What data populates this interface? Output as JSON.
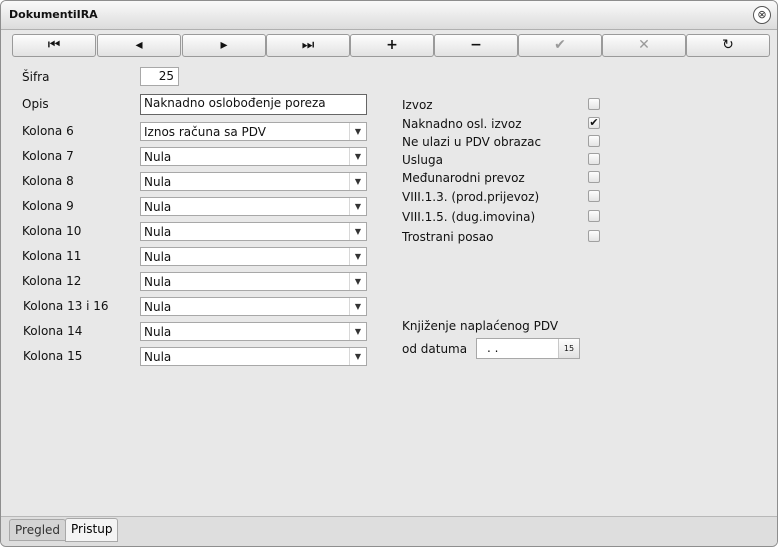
{
  "window": {
    "title": "DokumentiIRA",
    "close_symbol": "⊗"
  },
  "toolbar": {
    "buttons": [
      {
        "symbol": "⏮",
        "icon": "first-record-icon",
        "enabled": true
      },
      {
        "symbol": "◂",
        "icon": "previous-record-icon",
        "enabled": true
      },
      {
        "symbol": "▸",
        "icon": "next-record-icon",
        "enabled": true
      },
      {
        "symbol": "⏭",
        "icon": "last-record-icon",
        "enabled": true
      },
      {
        "symbol": "+",
        "icon": "add-icon",
        "enabled": true
      },
      {
        "symbol": "−",
        "icon": "delete-icon",
        "enabled": true
      },
      {
        "symbol": "✔",
        "icon": "save-icon",
        "enabled": false
      },
      {
        "symbol": "✕",
        "icon": "cancel-icon",
        "enabled": false
      },
      {
        "symbol": "↻",
        "icon": "refresh-icon",
        "enabled": true
      }
    ]
  },
  "form": {
    "sifra_label": "Šifra",
    "sifra_value": "25",
    "opis_label": "Opis",
    "opis_value": "Naknadno oslobođenje poreza",
    "columns": [
      {
        "label": "Kolona 6",
        "value": "Iznos računa sa PDV"
      },
      {
        "label": "Kolona 7",
        "value": "Nula"
      },
      {
        "label": "Kolona 8",
        "value": "Nula"
      },
      {
        "label": "Kolona 9",
        "value": "Nula"
      },
      {
        "label": "Kolona 10",
        "value": "Nula"
      },
      {
        "label": "Kolona 11",
        "value": "Nula"
      },
      {
        "label": "Kolona 12",
        "value": "Nula"
      },
      {
        "label": "Kolona 13 i 16",
        "value": "Nula"
      },
      {
        "label": "Kolona 14",
        "value": "Nula"
      },
      {
        "label": "Kolona 15",
        "value": "Nula"
      }
    ],
    "checkboxes": [
      {
        "label": "Izvoz",
        "checked": false
      },
      {
        "label": "Naknadno osl. izvoz",
        "checked": true
      },
      {
        "label": "Ne ulazi u PDV obrazac",
        "checked": false
      },
      {
        "label": "Usluga",
        "checked": false
      },
      {
        "label": "Međunarodni prevoz",
        "checked": false
      },
      {
        "label": "VIII.1.3. (prod.prijevoz)",
        "checked": false
      },
      {
        "label": "VIII.1.5. (dug.imovina)",
        "checked": false
      },
      {
        "label": "Trostrani posao",
        "checked": false
      }
    ],
    "knjizenje_label": "Knjiženje naplaćenog PDV",
    "od_datuma_label": "od datuma",
    "od_datuma_value": ". .",
    "calendar_symbol": "15"
  },
  "tabs": [
    {
      "label": "Pregled",
      "active": false
    },
    {
      "label": "Pristup",
      "active": true
    }
  ]
}
